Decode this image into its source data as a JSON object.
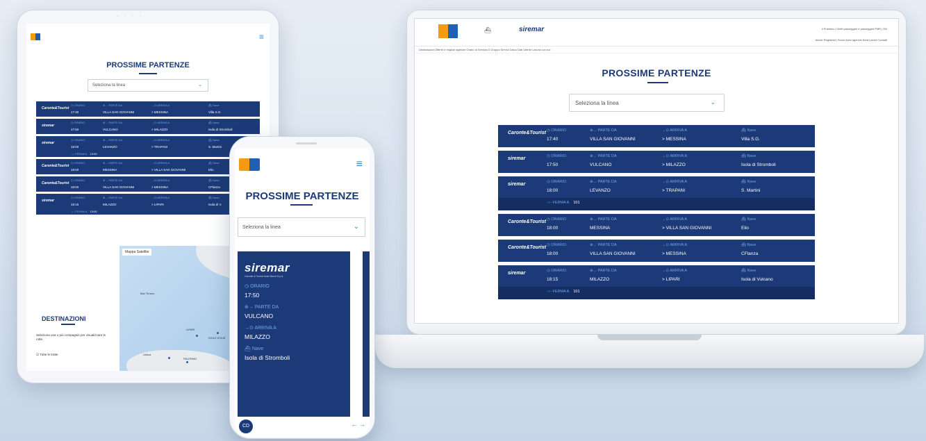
{
  "laptop": {
    "brand": "siremar",
    "top_links": "Il Pubblico | Diritti passeggeri e passeggeri PMR | EN",
    "nav": "Aiuole   Registrati   |   Scuro   Area agenzie   Area Lavori   Contatti",
    "subnav": "Destinazioni   Offerte e migliori agenzie   Orario di Servizio   Il Gruppo   Servizi Disco   Dati Utente   Lavora con noi",
    "title": "PROSSIME PARTENZE",
    "select_placeholder": "Seleziona la linea",
    "labels": {
      "orario": "ORARIO",
      "parte": "PARTE DA",
      "arriva": "ARRIVA A",
      "nave": "Nave",
      "fermata": "FERMA A"
    },
    "rows": [
      {
        "company": "Caronte&Tourist",
        "time": "17:40",
        "from": "VILLA SAN GIOVANNI",
        "to": "> MESSINA",
        "ship": "Villa S.G."
      },
      {
        "company": "siremar",
        "time": "17:50",
        "from": "VULCANO",
        "to": "> MILAZZO",
        "ship": "Isola di Stromboli"
      },
      {
        "company": "siremar",
        "time": "18:00",
        "from": "LEVANZO",
        "to": "> TRAPANI",
        "ship": "S. Martini",
        "stop": "101"
      },
      {
        "company": "Caronte&Tourist",
        "time": "18:00",
        "from": "MESSINA",
        "to": "> VILLA SAN GIOVANNI",
        "ship": "Elio"
      },
      {
        "company": "Caronte&Tourist",
        "time": "18:00",
        "from": "VILLA SAN GIOVANNI",
        "to": "> MESSINA",
        "ship": "CFlanza"
      },
      {
        "company": "siremar",
        "time": "18:15",
        "from": "MILAZZO",
        "to": "> LIPARI",
        "ship": "Isola di Vulcano",
        "stop": "101"
      }
    ]
  },
  "tablet": {
    "title": "PROSSIME PARTENZE",
    "select_placeholder": "Seleziona la linea",
    "labels": {
      "orario": "ORARIO",
      "parte": "PARTE DA",
      "arriva": "ARRIVA A",
      "nave": "Nave",
      "fermata": "FERMA A"
    },
    "rows": [
      {
        "company": "Caronte&Tourist",
        "time": "17:40",
        "from": "VILLA SAN GIOVANNI",
        "to": "> MESSINA",
        "ship": "Villa S.G."
      },
      {
        "company": "siremar",
        "time": "17:50",
        "from": "VULCANO",
        "to": "> MILAZZO",
        "ship": "Isola di Stromboli"
      },
      {
        "company": "siremar",
        "time": "18:00",
        "from": "LEVANZO",
        "to": "> TRAPANI",
        "ship": "S. Martini",
        "stop": "13:00"
      },
      {
        "company": "Caronte&Tourist",
        "time": "18:00",
        "from": "MESSINA",
        "to": "> VILLA SAN GIOVANNI",
        "ship": "Elio"
      },
      {
        "company": "Caronte&Tourist",
        "time": "18:00",
        "from": "VILLA SAN GIOVANNI",
        "to": "> MESSINA",
        "ship": "CFlanza"
      },
      {
        "company": "siremar",
        "time": "18:15",
        "from": "MILAZZO",
        "to": "> LIPARI",
        "ship": "Isola di V.",
        "stop": "13:00"
      }
    ],
    "map_tabs": "Mappa   Satellite",
    "map_labels": [
      "Mar Tirreno",
      "LIPARI",
      "ISOLE EOLIE",
      "PALERMO",
      "Ustica"
    ],
    "dest_title": "DESTINAZIONI",
    "dest_text": "Seleziona una o più compagnie per visualizzare le rotte.",
    "check_label": "Tutte le tratte"
  },
  "phone": {
    "title": "PROSSIME PARTENZE",
    "select_placeholder": "Seleziona la linea",
    "card": {
      "brand": "siremar",
      "brand_sub": "Caronte & Tourist Isole Minori S.p.A.",
      "orario_label": "ORARIO",
      "time": "17:50",
      "parte_label": "PARTE DA",
      "from": "VULCANO",
      "arriva_label": "ARRIVA A",
      "to": "MILAZZO",
      "nave_label": "Nave",
      "ship": "Isola di Stromboli"
    },
    "fab": "CD",
    "arrows": "← →"
  },
  "colors": {
    "navy": "#1c3a78",
    "accent": "#2b8be0",
    "label": "#76a7e6",
    "logo_orange": "#f39c12",
    "logo_blue": "#1f5fb4"
  }
}
